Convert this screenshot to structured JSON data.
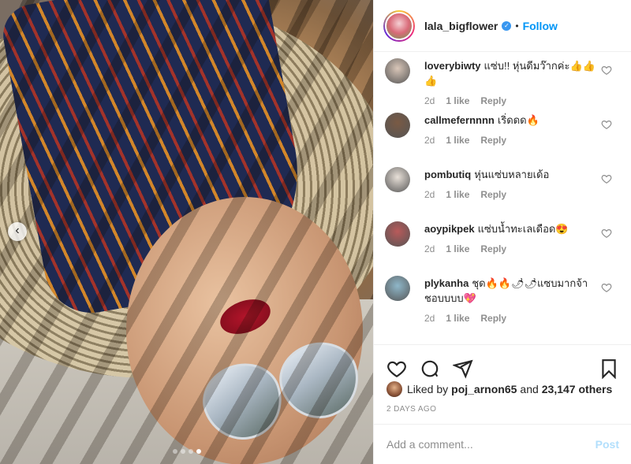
{
  "post": {
    "username": "lala_bigflower",
    "verified_icon": "verified-badge-icon",
    "separator": "•",
    "follow_label": "Follow"
  },
  "carousel": {
    "prev_icon": "chevron-left-icon",
    "prev_glyph": "‹",
    "total_slides": 4,
    "active_slide": 4
  },
  "comments": [
    {
      "user": "loverybiwty",
      "text": "แซ่บ!! หุ่นดีมว๊ากค่ะ👍👍👍",
      "age": "2d",
      "likes": "1 like",
      "reply": "Reply",
      "avatar_color": "#d9c6b8"
    },
    {
      "user": "callmefernnnn",
      "text": "เริ่ดดด🔥",
      "age": "2d",
      "likes": "1 like",
      "reply": "Reply",
      "avatar_color": "#7a5a44"
    },
    {
      "user": "pombutiq",
      "text": "หุ่นแซ่บหลายเด้อ",
      "age": "2d",
      "likes": "1 like",
      "reply": "Reply",
      "avatar_color": "#e8e0d8"
    },
    {
      "user": "aoypikpek",
      "text": "แซ่บน้ำทะเลเดือด😍",
      "age": "2d",
      "likes": "1 like",
      "reply": "Reply",
      "avatar_color": "#b95a5a"
    },
    {
      "user": "plykanha",
      "text": "ชุด🔥🔥🌶🌶แซบมากจ้า ชอบบบบ💖",
      "age": "2d",
      "likes": "1 like",
      "reply": "Reply",
      "avatar_color": "#8fb7c9"
    }
  ],
  "actions": {
    "like_icon": "heart-icon",
    "comment_icon": "comment-icon",
    "share_icon": "share-icon",
    "save_icon": "bookmark-icon"
  },
  "likes": {
    "prefix": "Liked by",
    "user": "poj_arnon65",
    "connector": "and",
    "count_text": "23,147 others"
  },
  "time_ago": "2 DAYS AGO",
  "add_comment": {
    "placeholder": "Add a comment...",
    "post_label": "Post"
  },
  "colors": {
    "accent": "#0095f6",
    "post_disabled": "#b2dffc",
    "meta_gray": "#8e8e8e"
  }
}
